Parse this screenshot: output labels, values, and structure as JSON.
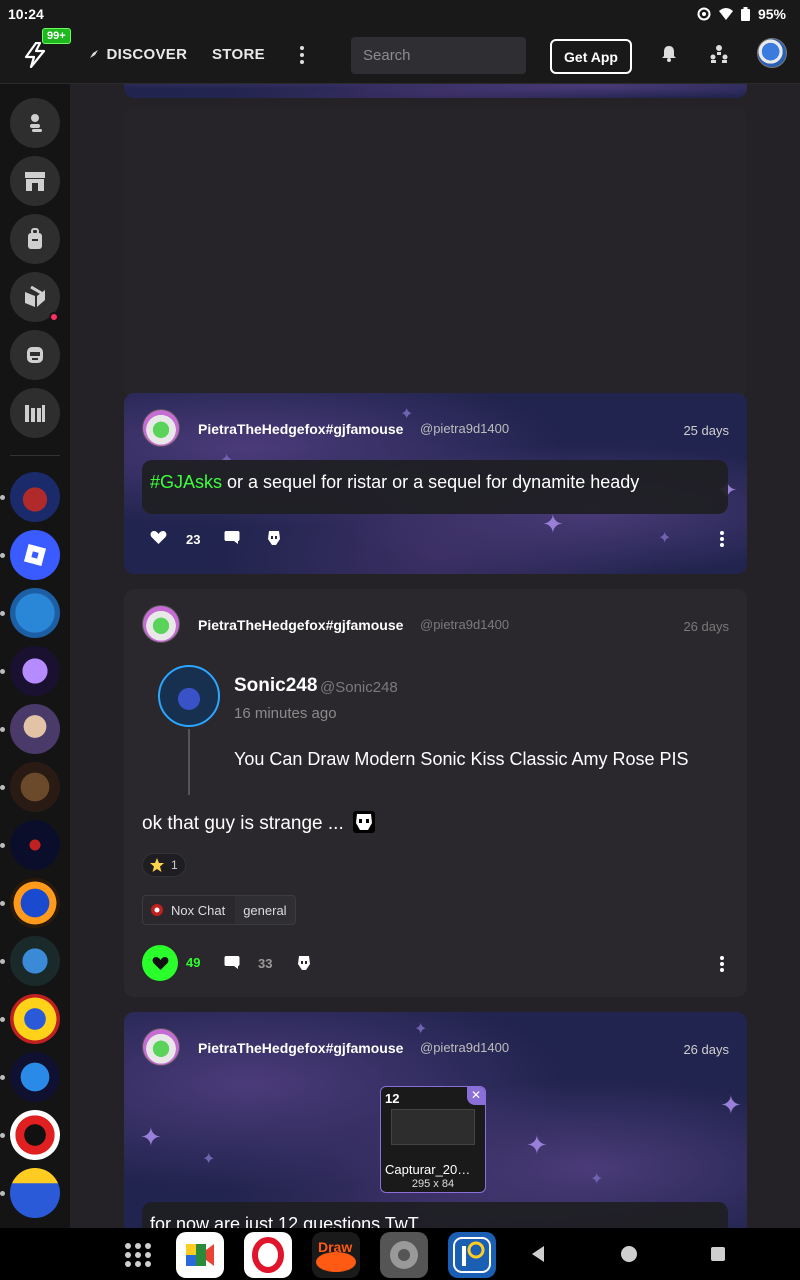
{
  "status_bar": {
    "time": "10:24",
    "battery": "95%"
  },
  "topnav": {
    "badge": "99+",
    "discover": "DISCOVER",
    "store": "STORE",
    "search_placeholder": "Search",
    "get_app": "Get App"
  },
  "posts": [
    {
      "author": "PietraTheHedgefox#gjfamouse",
      "handle": "@pietra9d1400",
      "time": "25 days",
      "hashtag": "#GJAsks",
      "text": " or a sequel for ristar or a sequel for dynamite heady",
      "likes": "23"
    },
    {
      "author": "PietraTheHedgefox#gjfamouse",
      "handle": "@pietra9d1400",
      "time": "26 days",
      "quote": {
        "name": "Sonic248",
        "handle": "@Sonic248",
        "time": "16 minutes ago",
        "text": "You Can Draw Modern Sonic Kiss Classic Amy Rose PIS"
      },
      "text": "ok that guy is strange ...",
      "reaction_count": "1",
      "channel": {
        "community": "Nox Chat",
        "name": "general"
      },
      "likes": "49",
      "comments": "33"
    },
    {
      "author": "PietraTheHedgefox#gjfamouse",
      "handle": "@pietra9d1400",
      "time": "26 days",
      "attachment": {
        "count": "12",
        "name": "Capturar_20…",
        "dims": "295 x 84"
      },
      "text": "for now are just 12 questions TwT"
    }
  ],
  "colors": {
    "accent_green": "#2bff2b",
    "notification_red": "#ff2e63",
    "banner_purple": "#21244e"
  }
}
